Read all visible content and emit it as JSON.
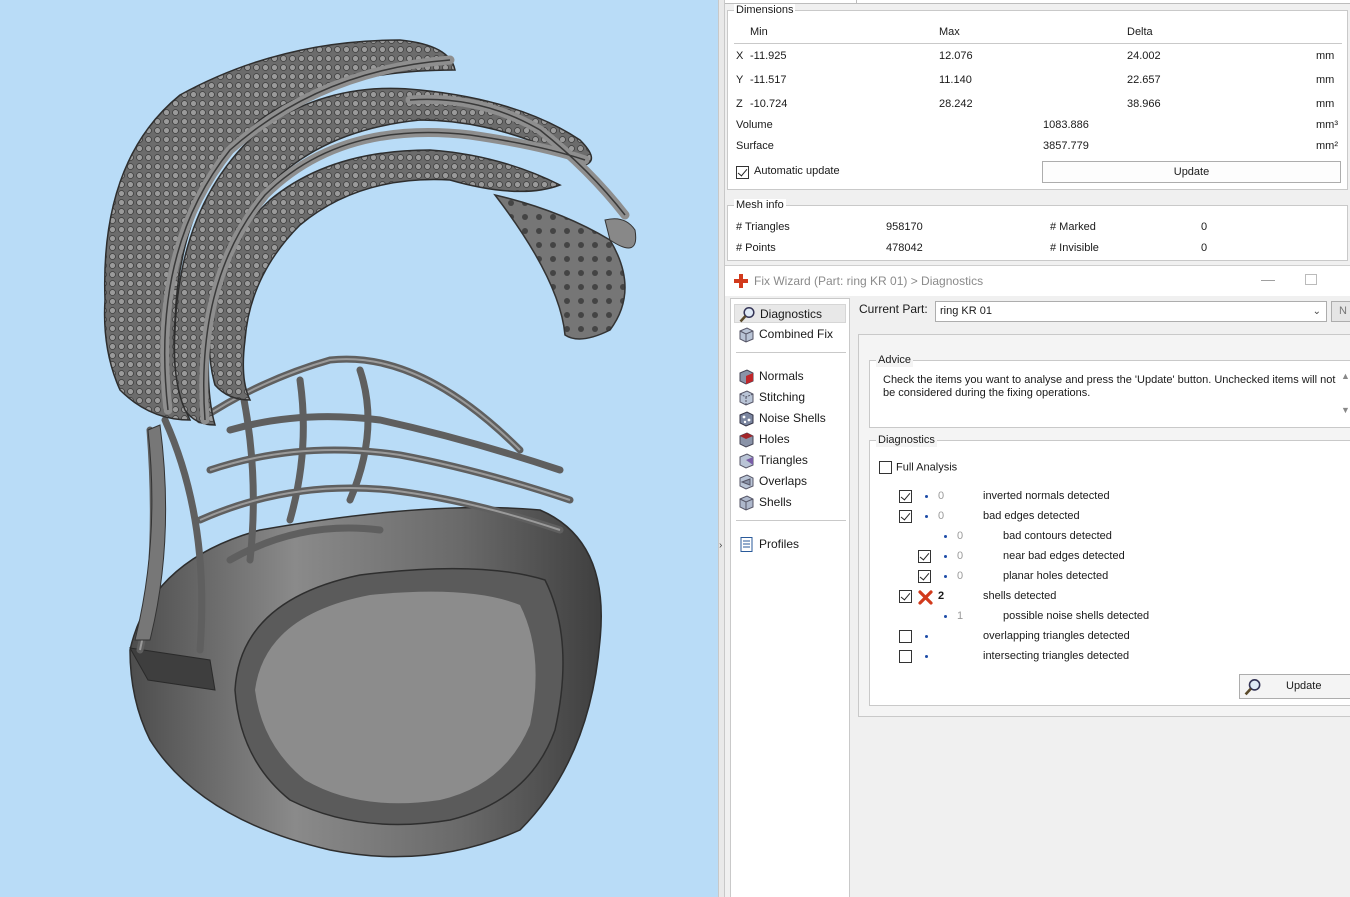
{
  "dimensions": {
    "title": "Dimensions",
    "headers": {
      "min": "Min",
      "max": "Max",
      "delta": "Delta"
    },
    "rows": [
      {
        "axis": "X",
        "min": "-11.925",
        "max": "12.076",
        "delta": "24.002",
        "unit": "mm"
      },
      {
        "axis": "Y",
        "min": "-11.517",
        "max": "11.140",
        "delta": "22.657",
        "unit": "mm"
      },
      {
        "axis": "Z",
        "min": "-10.724",
        "max": "28.242",
        "delta": "38.966",
        "unit": "mm"
      }
    ],
    "volume": {
      "label": "Volume",
      "value": "1083.886",
      "unit": "mm³"
    },
    "surface": {
      "label": "Surface",
      "value": "3857.779",
      "unit": "mm²"
    },
    "auto_update": {
      "label": "Automatic update",
      "checked": true
    },
    "update_label": "Update"
  },
  "mesh_info": {
    "title": "Mesh info",
    "triangles": {
      "label": "# Triangles",
      "value": "958170"
    },
    "points": {
      "label": "# Points",
      "value": "478042"
    },
    "marked": {
      "label": "# Marked",
      "value": "0"
    },
    "invisible": {
      "label": "# Invisible",
      "value": "0"
    }
  },
  "wizard": {
    "title": "Fix Wizard (Part: ring KR 01) > Diagnostics",
    "nav": [
      {
        "label": "Diagnostics",
        "icon": "magnifier-icon",
        "selected": true
      },
      {
        "label": "Combined Fix",
        "icon": "cube-icon"
      },
      {
        "label": "Normals",
        "icon": "normals-cube-icon"
      },
      {
        "label": "Stitching",
        "icon": "stitching-cube-icon"
      },
      {
        "label": "Noise Shells",
        "icon": "noise-shells-icon"
      },
      {
        "label": "Holes",
        "icon": "holes-cube-icon"
      },
      {
        "label": "Triangles",
        "icon": "triangles-cube-icon"
      },
      {
        "label": "Overlaps",
        "icon": "overlaps-cube-icon"
      },
      {
        "label": "Shells",
        "icon": "shells-cube-icon"
      },
      {
        "label": "Profiles",
        "icon": "document-icon"
      }
    ],
    "current_part_label": "Current Part:",
    "current_part": "ring KR 01",
    "next_label": "N",
    "advice": {
      "title": "Advice",
      "text": "Check the items you want to analyse and press the 'Update' button. Unchecked items will not be considered during the fixing operations."
    },
    "diagnostics": {
      "title": "Diagnostics",
      "full_analysis": {
        "label": "Full Analysis",
        "checked": false
      },
      "items": [
        {
          "checked": true,
          "count": "0",
          "label": "inverted normals detected",
          "level": 0,
          "has_checkbox": true
        },
        {
          "checked": true,
          "count": "0",
          "label": "bad edges detected",
          "level": 0,
          "has_checkbox": true
        },
        {
          "checked": false,
          "count": "0",
          "label": "bad contours detected",
          "level": 1,
          "has_checkbox": false
        },
        {
          "checked": true,
          "count": "0",
          "label": "near bad edges detected",
          "level": 1,
          "has_checkbox": true
        },
        {
          "checked": true,
          "count": "0",
          "label": "planar holes detected",
          "level": 1,
          "has_checkbox": true
        },
        {
          "checked": true,
          "count": "2",
          "label": "shells detected",
          "level": 0,
          "has_checkbox": true,
          "error": true
        },
        {
          "checked": false,
          "count": "1",
          "label": "possible noise shells detected",
          "level": 1,
          "has_checkbox": false
        },
        {
          "checked": false,
          "count": "",
          "label": "overlapping triangles detected",
          "level": 0,
          "has_checkbox": true
        },
        {
          "checked": false,
          "count": "",
          "label": "intersecting triangles detected",
          "level": 0,
          "has_checkbox": true
        }
      ],
      "update_label": "Update"
    }
  },
  "colors": {
    "viewport_bg": "#b9dcf7",
    "model_gray": "#6f6f6f",
    "error_red": "#d23a1c",
    "dot_blue": "#1f4ea8"
  }
}
